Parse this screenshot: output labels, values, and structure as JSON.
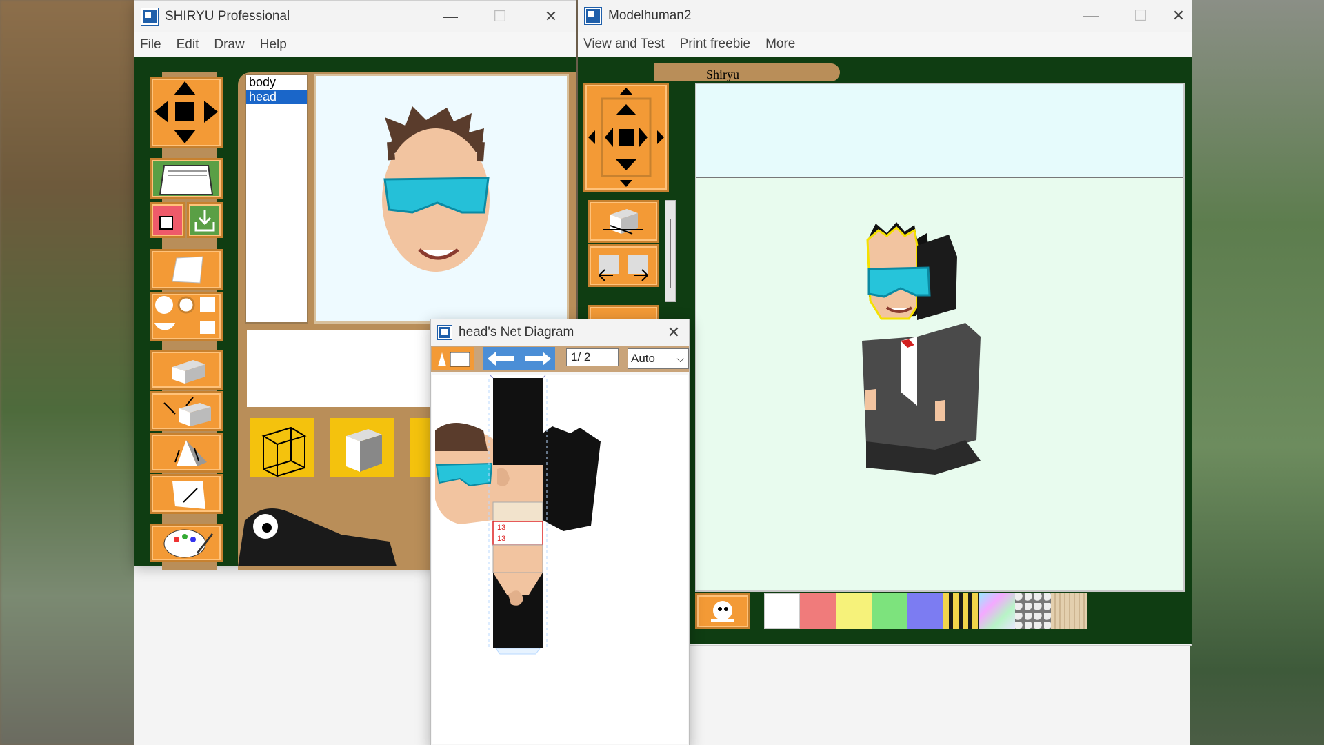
{
  "desktop": {
    "bg": "#7a6a55"
  },
  "win1": {
    "title": "SHIRYU Professional",
    "menu": [
      "File",
      "Edit",
      "Draw",
      "Help"
    ],
    "parts_list": [
      "body",
      "head"
    ],
    "selected_part": "head",
    "controls": {
      "minimize": "—",
      "maximize": "☐",
      "close": "✕"
    }
  },
  "win2": {
    "title": "Modelhuman2",
    "menu": [
      "View and Test",
      "Print freebie",
      "More"
    ],
    "tab_label": "Shiryu",
    "controls": {
      "minimize": "—",
      "maximize": "☐",
      "close": "✕"
    },
    "swatches": [
      "#ffffff",
      "#f07b7b",
      "#f6f27a",
      "#7de37d",
      "#7c7cf2",
      "pattern-yellow-black",
      "pattern-iridescent",
      "pattern-gravel",
      "pattern-wood"
    ]
  },
  "netdialog": {
    "title": "head's Net Diagram",
    "page": "1/ 2",
    "zoom_select": "Auto",
    "close": "✕",
    "glue_labels": [
      "13",
      "13"
    ]
  },
  "colors": {
    "client_bg": "#0f3d12",
    "button_orange": "#f39a36",
    "panel_tan": "#b98e59",
    "selection": "#1a66c9",
    "preview_bg": "#eefaff",
    "view_bg": "#e8fbee"
  }
}
